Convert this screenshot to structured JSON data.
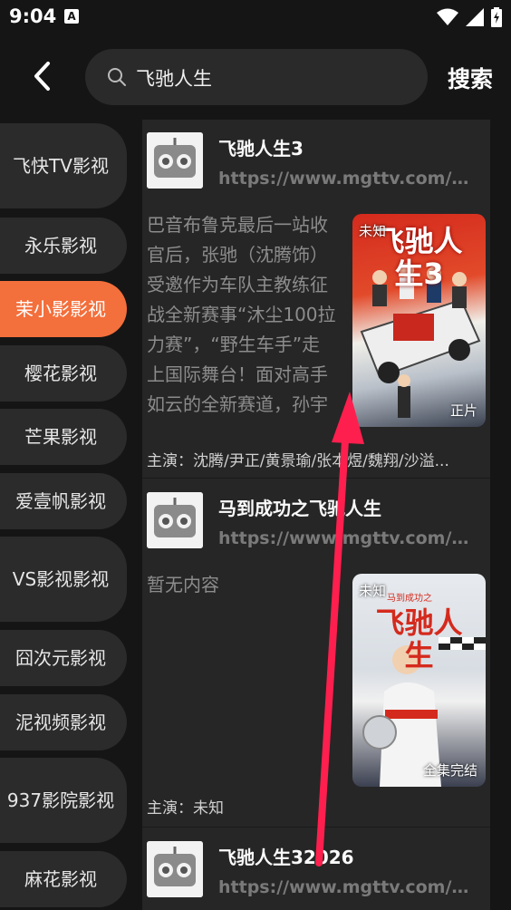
{
  "status": {
    "time": "9:04",
    "notif": "A"
  },
  "search": {
    "query": "飞驰人生",
    "button": "搜索"
  },
  "sidebar": {
    "items": [
      {
        "label": "飞快TV影视",
        "active": false
      },
      {
        "label": "永乐影视",
        "active": false
      },
      {
        "label": "茉小影影视",
        "active": true
      },
      {
        "label": "樱花影视",
        "active": false
      },
      {
        "label": "芒果影视",
        "active": false
      },
      {
        "label": "爱壹帆影视",
        "active": false
      },
      {
        "label": "VS影视影视",
        "active": false
      },
      {
        "label": "囧次元影视",
        "active": false
      },
      {
        "label": "泥视频影视",
        "active": false
      },
      {
        "label": "937影院影视",
        "active": false
      },
      {
        "label": "麻花影视",
        "active": false
      }
    ]
  },
  "results": [
    {
      "title": "飞驰人生3",
      "url": "https://www.mgttv.com/md...",
      "desc": "巴音布鲁克最后一站收官后，张驰（沈腾饰）受邀作为车队主教练征战全新赛事“沐尘100拉力赛”，“野生车手”走上国际舞台！面对高手如云的全新赛道，孙宇强（尹正",
      "cast": "主演：沈腾/尹正/黄景瑜/张本煜/魏翔/沙溢...",
      "poster_tl": "未知",
      "poster_br": "正片",
      "poster_title": "飞驰人生3"
    },
    {
      "title": "马到成功之飞驰人生",
      "url": "https://www.mgttv.com/md...",
      "desc": "暂无内容",
      "cast": "主演：未知",
      "poster_tl": "未知",
      "poster_br": "全集完结",
      "poster_title": "飞驰人生",
      "poster_subtitle": "马到成功之"
    },
    {
      "title": "飞驰人生32026",
      "url": "https://www.mgttv.com/md..."
    }
  ],
  "colors": {
    "accent": "#f36f3c",
    "annotation_arrow": "#ff1f4e"
  }
}
